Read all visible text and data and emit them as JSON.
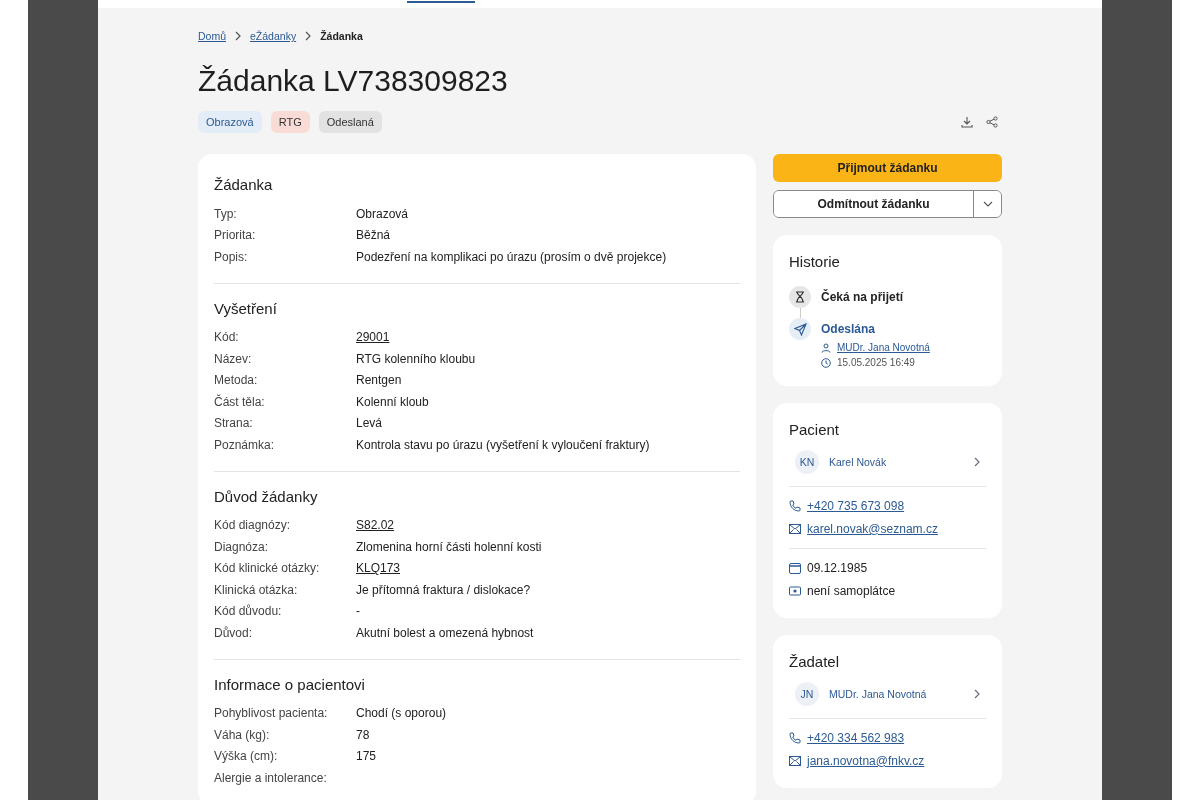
{
  "breadcrumb": [
    {
      "label": "Domů",
      "link": true
    },
    {
      "label": "eŽádanky",
      "link": true
    },
    {
      "label": "Žádanka",
      "link": false
    }
  ],
  "title": "Žádanka LV738309823",
  "tags": [
    {
      "label": "Obrazová",
      "color": "#e3edf8"
    },
    {
      "label": "RTG",
      "color": "#fadcd7"
    },
    {
      "label": "Odeslaná",
      "color": "#e2e2e2"
    }
  ],
  "sections": [
    {
      "title": "Žádanka",
      "rows": [
        {
          "label": "Typ:",
          "value": "Obrazová",
          "link": false
        },
        {
          "label": "Priorita:",
          "value": "Běžná",
          "link": false
        },
        {
          "label": "Popis:",
          "value": "Podezření na komplikaci po úrazu (prosím o dvě projekce)",
          "link": false
        }
      ]
    },
    {
      "title": "Vyšetření",
      "rows": [
        {
          "label": "Kód:",
          "value": "29001",
          "link": true
        },
        {
          "label": "Název:",
          "value": "RTG kolenního kloubu",
          "link": false
        },
        {
          "label": "Metoda:",
          "value": "Rentgen",
          "link": false
        },
        {
          "label": "Část těla:",
          "value": "Kolenní kloub",
          "link": false
        },
        {
          "label": "Strana:",
          "value": "Levá",
          "link": false
        },
        {
          "label": "Poznámka:",
          "value": "Kontrola stavu po úrazu (vyšetření k vyloučení fraktury)",
          "link": false
        }
      ]
    },
    {
      "title": "Důvod žádanky",
      "rows": [
        {
          "label": "Kód diagnózy:",
          "value": "S82.02",
          "link": true
        },
        {
          "label": "Diagnóza:",
          "value": "Zlomenina horní části holenní kosti",
          "link": false
        },
        {
          "label": "Kód klinické otázky:",
          "value": "KLQ173",
          "link": true
        },
        {
          "label": "Klinická otázka:",
          "value": "Je přítomná fraktura / dislokace?",
          "link": false
        },
        {
          "label": "Kód důvodu:",
          "value": "-",
          "link": false
        },
        {
          "label": "Důvod:",
          "value": "Akutní bolest a omezená hybnost",
          "link": false
        }
      ]
    },
    {
      "title": "Informace o pacientovi",
      "rows": [
        {
          "label": "Pohyblivost pacienta:",
          "value": "Chodí (s oporou)",
          "link": false
        },
        {
          "label": "Váha (kg):",
          "value": "78",
          "link": false
        },
        {
          "label": "Výška (cm):",
          "value": "175",
          "link": false
        },
        {
          "label": "Alergie a intolerance:"
        }
      ]
    }
  ],
  "actions": {
    "accept": "Přijmout žádanku",
    "reject": "Odmítnout žádanku"
  },
  "history": {
    "title": "Historie",
    "items": [
      {
        "kind": "pending",
        "label": "Čeká na přijetí"
      },
      {
        "kind": "sent",
        "label": "Odeslána",
        "person": "MUDr. Jana Novotná",
        "time": "15.05.2025 16:49"
      }
    ]
  },
  "cards": [
    {
      "title": "Pacient",
      "initials": "KN",
      "name": "Karel Novák",
      "groups": [
        [
          {
            "kind": "phone",
            "text": "+420 735 673 098"
          },
          {
            "kind": "email",
            "text": "karel.novak@seznam.cz"
          }
        ],
        [
          {
            "kind": "date",
            "text": "09.12.1985"
          },
          {
            "kind": "insurance",
            "text": "není samoplátce"
          }
        ]
      ]
    },
    {
      "title": "Žadatel",
      "initials": "JN",
      "name": "MUDr. Jana Novotná",
      "groups": [
        [
          {
            "kind": "phone",
            "text": "+420 334 562 983"
          },
          {
            "kind": "email",
            "text": "jana.novotna@fnkv.cz"
          }
        ]
      ]
    }
  ]
}
